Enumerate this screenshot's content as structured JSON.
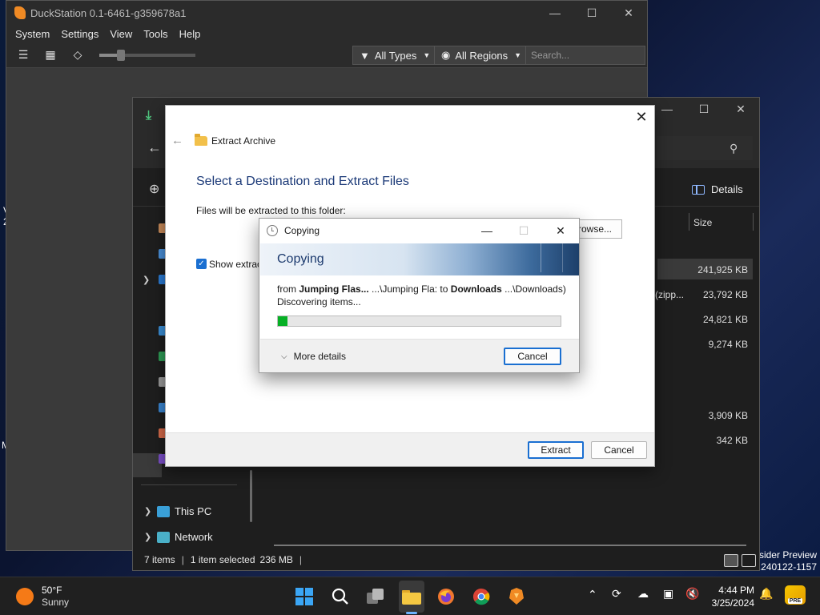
{
  "desktop": {
    "left_edge_1": "V",
    "left_edge_2": "2",
    "left_edge_3": "M",
    "watermark_line1": "sider Preview",
    "watermark_line2": ".240122-1157"
  },
  "duckstation": {
    "title": "DuckStation 0.1-6461-g359678a1",
    "menu": [
      "System",
      "Settings",
      "View",
      "Tools",
      "Help"
    ],
    "filter_types": "All Types",
    "filter_regions": "All Regions",
    "search_placeholder": "Search..."
  },
  "explorer": {
    "details_label": "Details",
    "col_size": "Size",
    "file_sizes": [
      "241,925 KB",
      "23,792 KB",
      "24,821 KB",
      "9,274 KB",
      "3,909 KB",
      "342 KB"
    ],
    "file_type_partial": "(zipp...",
    "sidebar": {
      "this_pc": "This PC",
      "network": "Network"
    },
    "status": {
      "items": "7 items",
      "selected": "1 item selected",
      "size": "236 MB"
    }
  },
  "extract_dialog": {
    "title": "Extract Archive",
    "heading": "Select a Destination and Extract Files",
    "folder_label": "Files will be extracted to this folder:",
    "browse_label": "Browse...",
    "show_label": "Show extract",
    "extract_button": "Extract",
    "cancel_button": "Cancel"
  },
  "copy_dialog": {
    "title": "Copying",
    "banner": "Copying",
    "from_word": "from",
    "source_bold": "Jumping Flas...",
    "source_path": "...\\Jumping Fla:",
    "to_word": "to",
    "dest_bold": "Downloads",
    "dest_path": "...\\Downloads)",
    "status": "Discovering items...",
    "progress": 0.035,
    "more_details": "More details",
    "cancel_button": "Cancel"
  },
  "taskbar": {
    "temperature": "50°F",
    "condition": "Sunny",
    "time": "4:44 PM",
    "date": "3/25/2024",
    "badge": "PRE"
  }
}
